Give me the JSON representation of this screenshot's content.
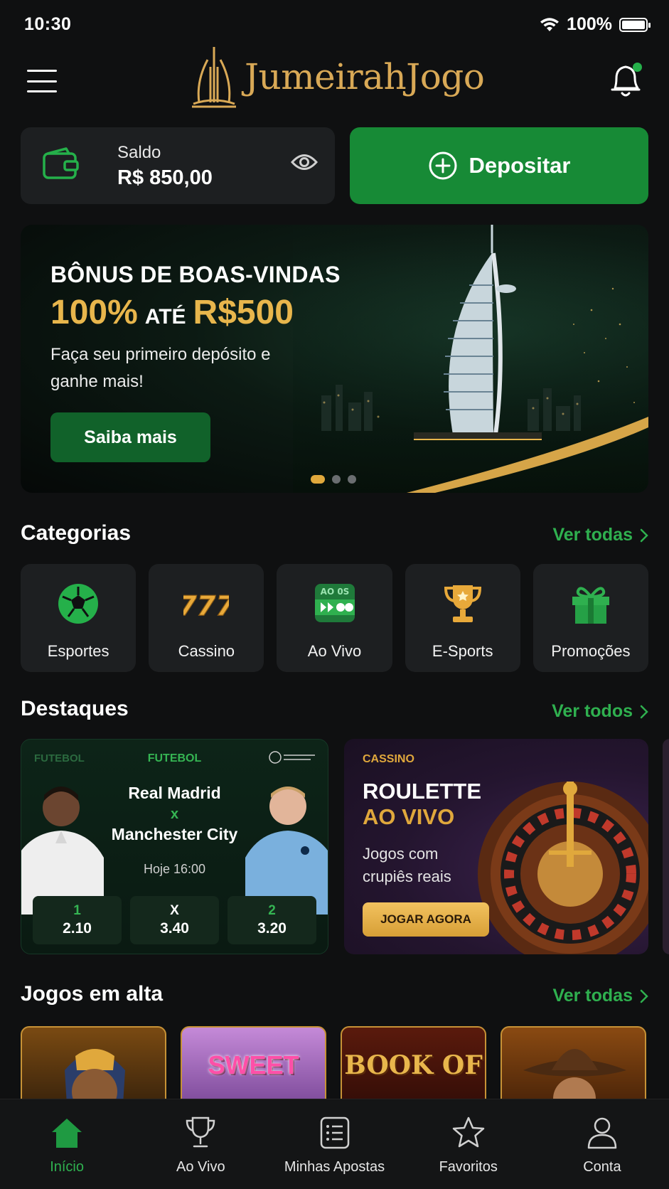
{
  "status_bar": {
    "time": "10:30",
    "battery": "100%"
  },
  "header": {
    "logo_text": "JumeirahJogo",
    "icons": [
      "menu-icon",
      "bell-icon"
    ]
  },
  "balance": {
    "label": "Saldo",
    "value": "R$ 850,00",
    "deposit_label": "Depositar"
  },
  "banner": {
    "title": "BÔNUS DE BOAS-VINDAS",
    "offer_pct": "100%",
    "offer_ate": "ATÉ",
    "offer_amount": "R$500",
    "description": "Faça seu primeiro depósito e ganhe mais!",
    "cta": "Saiba mais",
    "slides": 3,
    "active_slide": 1
  },
  "categories": {
    "title": "Categorias",
    "link": "Ver todas",
    "items": [
      {
        "label": "Esportes",
        "icon": "soccer-ball-icon"
      },
      {
        "label": "Cassino",
        "icon": "slot-777-icon"
      },
      {
        "label": "Ao Vivo",
        "icon": "live-play-icon",
        "badge": "AO 0S"
      },
      {
        "label": "E-Sports",
        "icon": "trophy-icon"
      },
      {
        "label": "Promoções",
        "icon": "gift-icon"
      }
    ]
  },
  "highlights": {
    "title": "Destaques",
    "link": "Ver todos",
    "match": {
      "tag_faded": "FUTEBOL",
      "tag": "FUTEBOL",
      "home": "Real Madrid",
      "vs": "x",
      "away": "Manchester City",
      "time": "Hoje 16:00",
      "odds": [
        {
          "label": "1",
          "value": "2.10"
        },
        {
          "label": "X",
          "value": "3.40"
        },
        {
          "label": "2",
          "value": "3.20"
        }
      ]
    },
    "casino": {
      "tag": "CASSINO",
      "title": "ROULETTE",
      "subtitle": "AO VIVO",
      "description": "Jogos com crupiês reais",
      "cta": "JOGAR AGORA"
    }
  },
  "trending": {
    "title": "Jogos em alta",
    "link": "Ver todas",
    "games": [
      {
        "text": ""
      },
      {
        "text": "SWEET"
      },
      {
        "text": "BOOK OF"
      },
      {
        "text": ""
      }
    ]
  },
  "bottom_nav": {
    "items": [
      {
        "label": "Início",
        "icon": "home-icon",
        "active": true
      },
      {
        "label": "Ao Vivo",
        "icon": "trophy-icon",
        "active": false
      },
      {
        "label": "Minhas Apostas",
        "icon": "bet-slip-icon",
        "active": false
      },
      {
        "label": "Favoritos",
        "icon": "star-icon",
        "active": false
      },
      {
        "label": "Conta",
        "icon": "user-icon",
        "active": false
      }
    ]
  },
  "colors": {
    "accent_green": "#178a36",
    "gold": "#e0a83c",
    "background": "#0f1011"
  }
}
